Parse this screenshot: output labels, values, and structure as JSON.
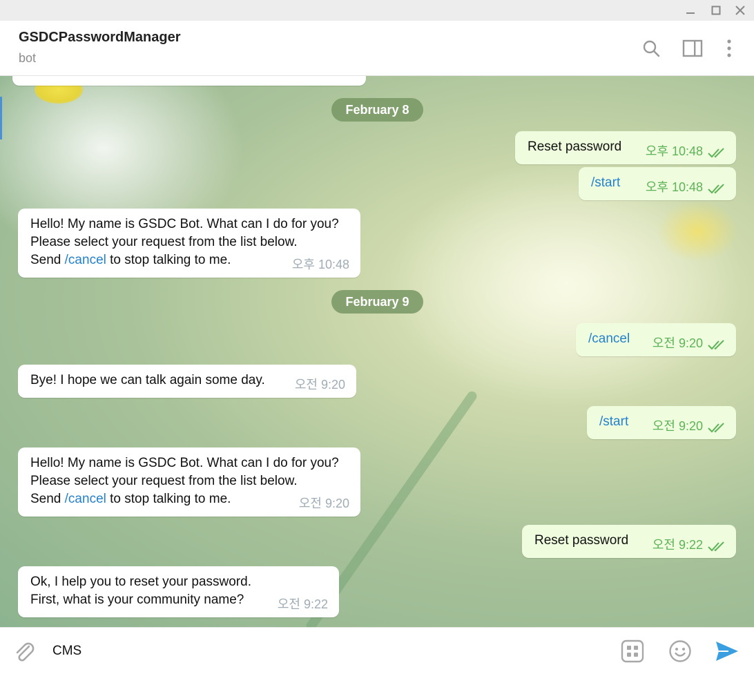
{
  "header": {
    "title": "GSDCPasswordManager",
    "subtitle": "bot"
  },
  "chat": {
    "dates": [
      "February 8",
      "February 9"
    ],
    "messages": [
      {
        "dir": "out",
        "text": "Reset password",
        "time": "오후 10:48"
      },
      {
        "dir": "out",
        "text": "/start",
        "time": "오후 10:48"
      },
      {
        "dir": "in",
        "lines": [
          "Hello! My name is GSDC Bot. What can I do for you?",
          "Please select your request from the list below."
        ],
        "send_prefix": "Send ",
        "send_link": "/cancel",
        "send_suffix": " to stop talking to me.",
        "time": "오후 10:48"
      },
      {
        "dir": "out",
        "text": "/cancel",
        "time": "오전 9:20"
      },
      {
        "dir": "in",
        "text": "Bye! I hope we can talk again some day.",
        "time": "오전 9:20"
      },
      {
        "dir": "out",
        "text": "/start",
        "time": "오전 9:20"
      },
      {
        "dir": "in",
        "lines": [
          "Hello! My name is GSDC Bot. What can I do for you?",
          "Please select your request from the list below."
        ],
        "send_prefix": "Send ",
        "send_link": "/cancel",
        "send_suffix": " to stop talking to me.",
        "time": "오전 9:20"
      },
      {
        "dir": "out",
        "text": "Reset password",
        "time": "오전 9:22"
      },
      {
        "dir": "in",
        "lines": [
          "Ok, I help you to reset your password.",
          "First, what is your community name?"
        ],
        "time": "오전 9:22"
      }
    ]
  },
  "composer": {
    "value": "CMS"
  },
  "icons": {
    "search": "search-icon",
    "panel": "sidebar-toggle-icon",
    "more": "more-vertical-icon",
    "attach": "paperclip-icon",
    "commands": "bot-commands-icon",
    "emoji": "emoji-icon",
    "send": "send-icon"
  },
  "colors": {
    "outgoing_bubble": "#effdde",
    "incoming_bubble": "#ffffff",
    "link": "#2481cc",
    "read_check": "#5db358",
    "date_pill": "#7c9a64"
  }
}
